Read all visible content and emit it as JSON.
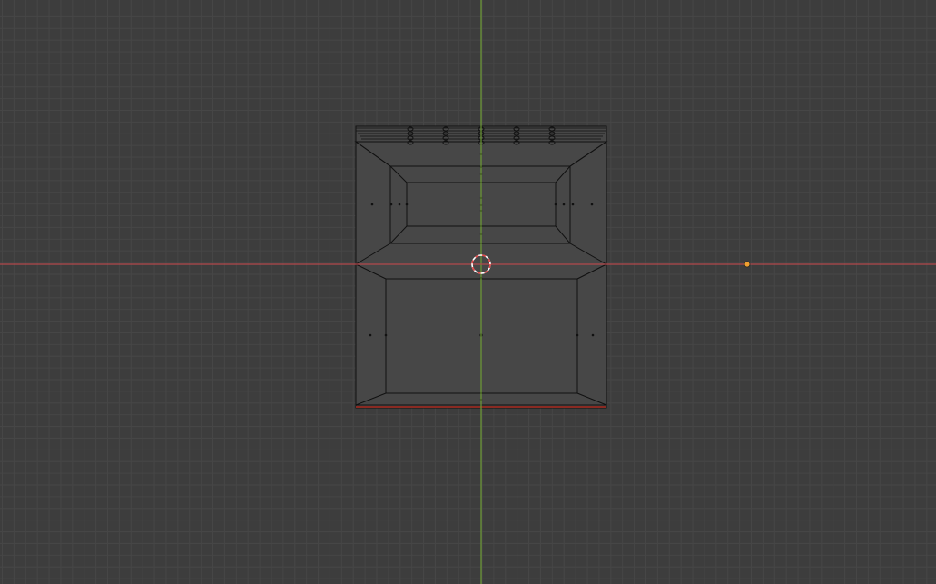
{
  "viewport": {
    "view": "top-orthographic",
    "shading": "wireframe",
    "grid": true
  },
  "colors": {
    "background": "#3d3d3d",
    "grid_line": "#464646",
    "x_axis": "#b3484c",
    "y_axis": "#6e9d35",
    "wireframe_edge": "#111111",
    "face_fill": "#474747",
    "cursor_red": "#e14747",
    "cursor_white": "#ffffff",
    "light_origin": "#f0a030"
  }
}
